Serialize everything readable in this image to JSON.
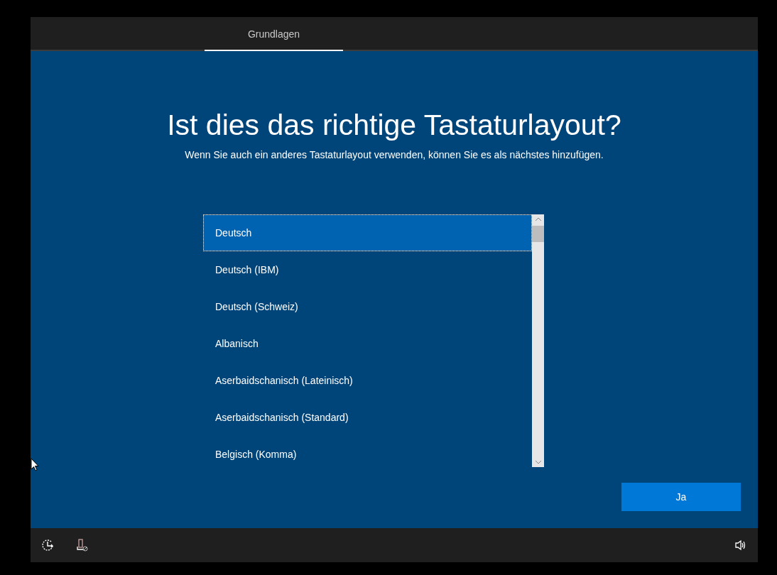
{
  "tabs": [
    {
      "label": "Grundlagen",
      "selected": true
    }
  ],
  "title": "Ist dies das richtige Tastaturlayout?",
  "subtitle": "Wenn Sie auch ein anderes Tastaturlayout verwenden, können Sie es als nächstes hinzufügen.",
  "layouts": [
    {
      "label": "Deutsch",
      "selected": true
    },
    {
      "label": "Deutsch (IBM)",
      "selected": false
    },
    {
      "label": "Deutsch (Schweiz)",
      "selected": false
    },
    {
      "label": "Albanisch",
      "selected": false
    },
    {
      "label": "Aserbaidschanisch (Lateinisch)",
      "selected": false
    },
    {
      "label": "Aserbaidschanisch (Standard)",
      "selected": false
    },
    {
      "label": "Belgisch (Komma)",
      "selected": false
    }
  ],
  "button": "Ja"
}
